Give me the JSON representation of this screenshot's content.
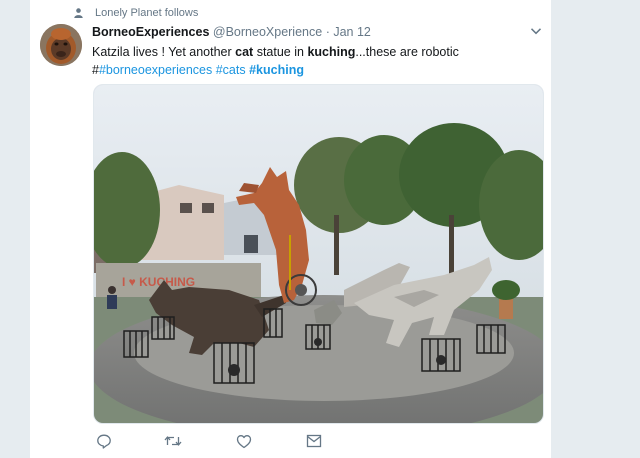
{
  "context": {
    "icon": "person-icon",
    "text": "Lonely Planet follows"
  },
  "tweet": {
    "display_name": "BorneoExperiences",
    "handle": "@BorneoXperience",
    "separator": "·",
    "date": "Jan 12",
    "line1": {
      "part1": "Katzila lives ! Yet another ",
      "bold1": "cat",
      "part2": " statue in ",
      "bold2": "kuching",
      "part3": "...these are robotic"
    },
    "line2": {
      "hash_prefix": "#",
      "tag1": "#borneoexperiences",
      "tag2": "#cats",
      "tag3": "#kuching"
    },
    "mural_text": "I ♥ KUCHING"
  },
  "actions": [
    "reply-icon",
    "retweet-icon",
    "like-icon",
    "message-icon"
  ],
  "colors": {
    "link": "#1b95e0",
    "muted": "#657786",
    "background": "#e6ecf0"
  }
}
